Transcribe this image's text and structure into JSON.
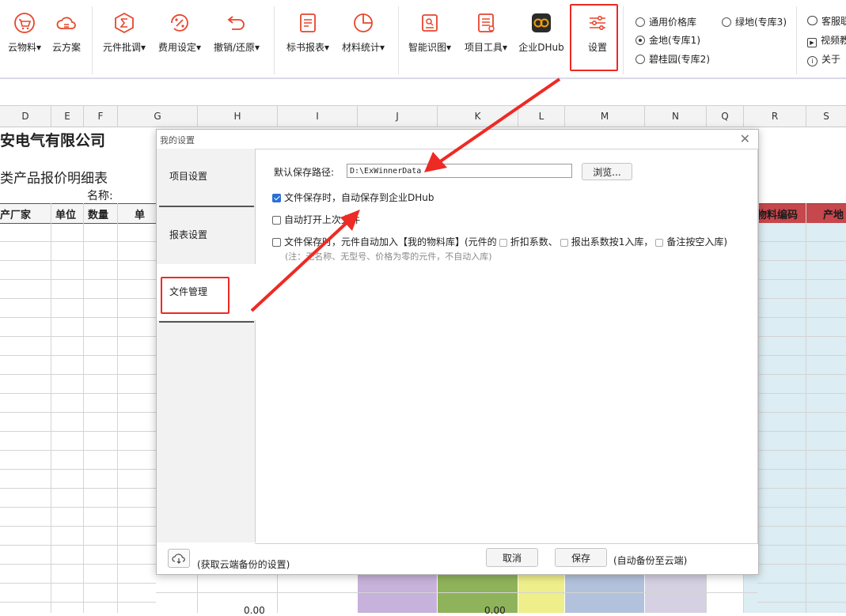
{
  "ribbon": {
    "buttons": [
      {
        "label": "云物料▾",
        "icon": "cart-icon"
      },
      {
        "label": "云方案",
        "icon": "cloud-icon"
      },
      {
        "label": "元件批调▾",
        "icon": "sigma-icon"
      },
      {
        "label": "费用设定▾",
        "icon": "percent-icon"
      },
      {
        "label": "撤销/还原▾",
        "icon": "undo-icon"
      },
      {
        "label": "标书报表▾",
        "icon": "report-icon"
      },
      {
        "label": "材料统计▾",
        "icon": "pie-chart-icon"
      },
      {
        "label": "智能识图▾",
        "icon": "scan-icon"
      },
      {
        "label": "项目工具▾",
        "icon": "tools-icon"
      },
      {
        "label": "企业DHub",
        "icon": "dhub-logo-icon"
      },
      {
        "label": "设置",
        "icon": "sliders-icon"
      }
    ],
    "libraries": [
      {
        "label": "通用价格库",
        "selected": false
      },
      {
        "label": "金地(专库1)",
        "selected": true
      },
      {
        "label": "碧桂园(专库2)",
        "selected": false
      },
      {
        "label": "绿地(专库3)",
        "selected": false
      }
    ],
    "side": [
      {
        "label": "客服联",
        "icon": "chat-icon"
      },
      {
        "label": "视频教",
        "icon": "video-icon"
      },
      {
        "label": "关于",
        "icon": "info-icon"
      }
    ]
  },
  "columns": [
    "D",
    "E",
    "F",
    "G",
    "H",
    "I",
    "J",
    "K",
    "L",
    "M",
    "N",
    "Q",
    "R",
    "S"
  ],
  "sheet": {
    "company": "安电气有限公司",
    "subtitle": "类产品报价明细表",
    "name_label": "名称:",
    "headers_left": [
      "产厂家",
      "单位",
      "数量",
      "单"
    ],
    "headers_right": [
      "物料编码",
      "产地"
    ],
    "bottom_values": [
      "0.00",
      "0.00"
    ]
  },
  "dialog": {
    "title": "我的设置",
    "close": "✕",
    "nav": [
      "项目设置",
      "报表设置",
      "文件管理"
    ],
    "active_nav": 2,
    "path_label": "默认保存路径:",
    "path_value": "D:\\ExWinnerData",
    "browse": "浏览...",
    "opt1": "文件保存时，自动保存到企业DHub",
    "opt2": "自动打开上次文件",
    "opt3_prefix": "文件保存时，元件自动加入【我的物料库】(元件的",
    "opt3_sub1": "折扣系数、",
    "opt3_sub2": "报出系数按1入库，",
    "opt3_sub3": "备注按空入库)",
    "note": "(注：无名称、无型号、价格为零的元件，不自动入库)",
    "cloud_text": "(获取云端备份的设置)",
    "cancel": "取消",
    "save": "保存",
    "save_note": "(自动备份至云端)"
  },
  "colors": {
    "accent": "#e8452c",
    "highlight": "#ee2a24",
    "checkbox": "#2a6fd6"
  }
}
